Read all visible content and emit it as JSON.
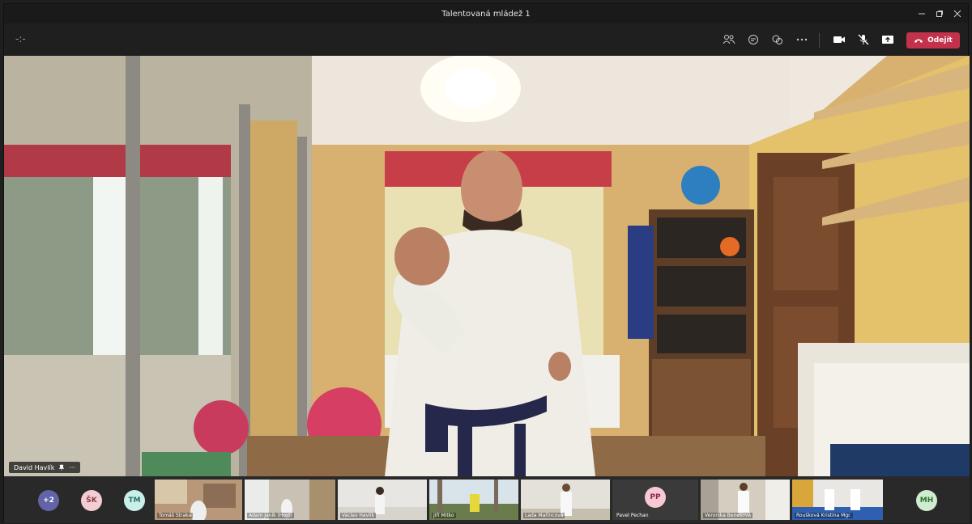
{
  "window": {
    "title": "Talentovaná mládež 1"
  },
  "toolbar": {
    "back_glyph": "-:-",
    "leave_label": "Odejít"
  },
  "stage": {
    "speaker_name": "David Havlík"
  },
  "gallery": {
    "overflow_label": "+2",
    "avatars": [
      {
        "initials": "ŠK",
        "bg": "#f4cdd2",
        "fg": "#8a3b46"
      },
      {
        "initials": "TM",
        "bg": "#c9efe9",
        "fg": "#2c6e68"
      },
      {
        "initials": "PP",
        "bg": "#f6c9d4",
        "fg": "#8b2c4a"
      },
      {
        "initials": "MH",
        "bg": "#cfeccf",
        "fg": "#2f6e2f"
      }
    ],
    "tiles": [
      {
        "name": "Tomáš Straka"
      },
      {
        "name": "Adam Janík (Host)"
      },
      {
        "name": "Václav Havlík"
      },
      {
        "name": "Jiří Mitko"
      },
      {
        "name": "Lada Mařincová"
      },
      {
        "name": "Pavel Pechan"
      },
      {
        "name": "Veronika Benešová"
      },
      {
        "name": "Roušková Kristina Mgr."
      }
    ]
  },
  "colors": {
    "leave_button": "#c4314b",
    "overflow_avatar": "#6264a7",
    "window_bg": "#201f1f"
  }
}
